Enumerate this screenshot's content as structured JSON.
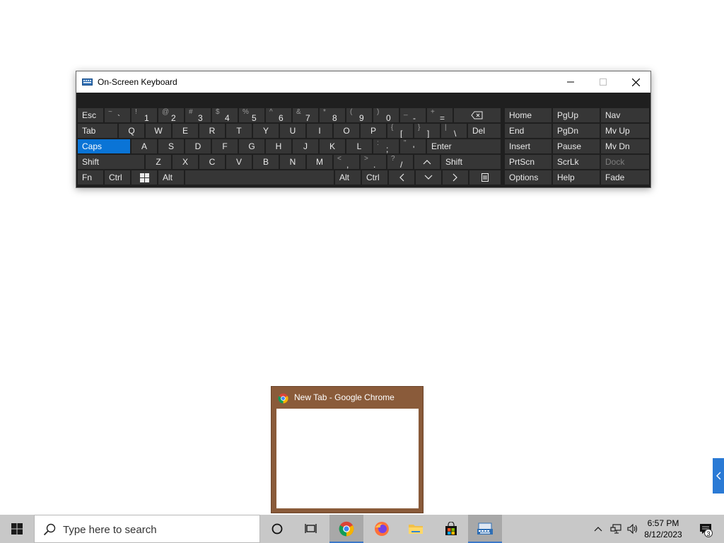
{
  "osk": {
    "title": "On-Screen Keyboard",
    "rows": {
      "row1": {
        "esc": "Esc",
        "keys": [
          {
            "shift": "~",
            "main": "`"
          },
          {
            "shift": "!",
            "main": "1"
          },
          {
            "shift": "@",
            "main": "2"
          },
          {
            "shift": "#",
            "main": "3"
          },
          {
            "shift": "$",
            "main": "4"
          },
          {
            "shift": "%",
            "main": "5"
          },
          {
            "shift": "^",
            "main": "6"
          },
          {
            "shift": "&",
            "main": "7"
          },
          {
            "shift": "*",
            "main": "8"
          },
          {
            "shift": "(",
            "main": "9"
          },
          {
            "shift": ")",
            "main": "0"
          },
          {
            "shift": "_",
            "main": "-"
          },
          {
            "shift": "+",
            "main": "="
          }
        ]
      },
      "row2": {
        "tab": "Tab",
        "letters": [
          "Q",
          "W",
          "E",
          "R",
          "T",
          "Y",
          "U",
          "I",
          "O",
          "P"
        ],
        "brackets": [
          {
            "shift": "{",
            "main": "["
          },
          {
            "shift": "}",
            "main": "]"
          },
          {
            "shift": "|",
            "main": "\\"
          }
        ],
        "del": "Del"
      },
      "row3": {
        "caps": "Caps",
        "letters": [
          "A",
          "S",
          "D",
          "F",
          "G",
          "H",
          "J",
          "K",
          "L"
        ],
        "punct": [
          {
            "shift": ":",
            "main": ";"
          },
          {
            "shift": "\"",
            "main": "'"
          }
        ],
        "enter": "Enter"
      },
      "row4": {
        "shift_left": "Shift",
        "letters": [
          "Z",
          "X",
          "C",
          "V",
          "B",
          "N",
          "M"
        ],
        "punct": [
          {
            "shift": "<",
            "main": ","
          },
          {
            "shift": ">",
            "main": "."
          },
          {
            "shift": "?",
            "main": "/"
          }
        ],
        "shift_right": "Shift"
      },
      "row5": {
        "fn": "Fn",
        "ctrl_left": "Ctrl",
        "alt_left": "Alt",
        "alt_right": "Alt",
        "ctrl_right": "Ctrl"
      }
    },
    "nav": {
      "col1": [
        "Home",
        "End",
        "Insert",
        "PrtScn",
        "Options"
      ],
      "col2": [
        "PgUp",
        "PgDn",
        "Pause",
        "ScrLk",
        "Help"
      ],
      "col3": [
        "Nav",
        "Mv Up",
        "Mv Dn",
        "Dock",
        "Fade"
      ]
    },
    "active_key": "Caps"
  },
  "preview": {
    "title": "New Tab - Google Chrome"
  },
  "taskbar": {
    "search_placeholder": "Type here to search",
    "time": "6:57 PM",
    "date": "8/12/2023",
    "notification_count": "3"
  },
  "colors": {
    "accent": "#0a74d6",
    "preview_frame": "#8a5b3a",
    "taskbar": "#c8c8c8"
  }
}
